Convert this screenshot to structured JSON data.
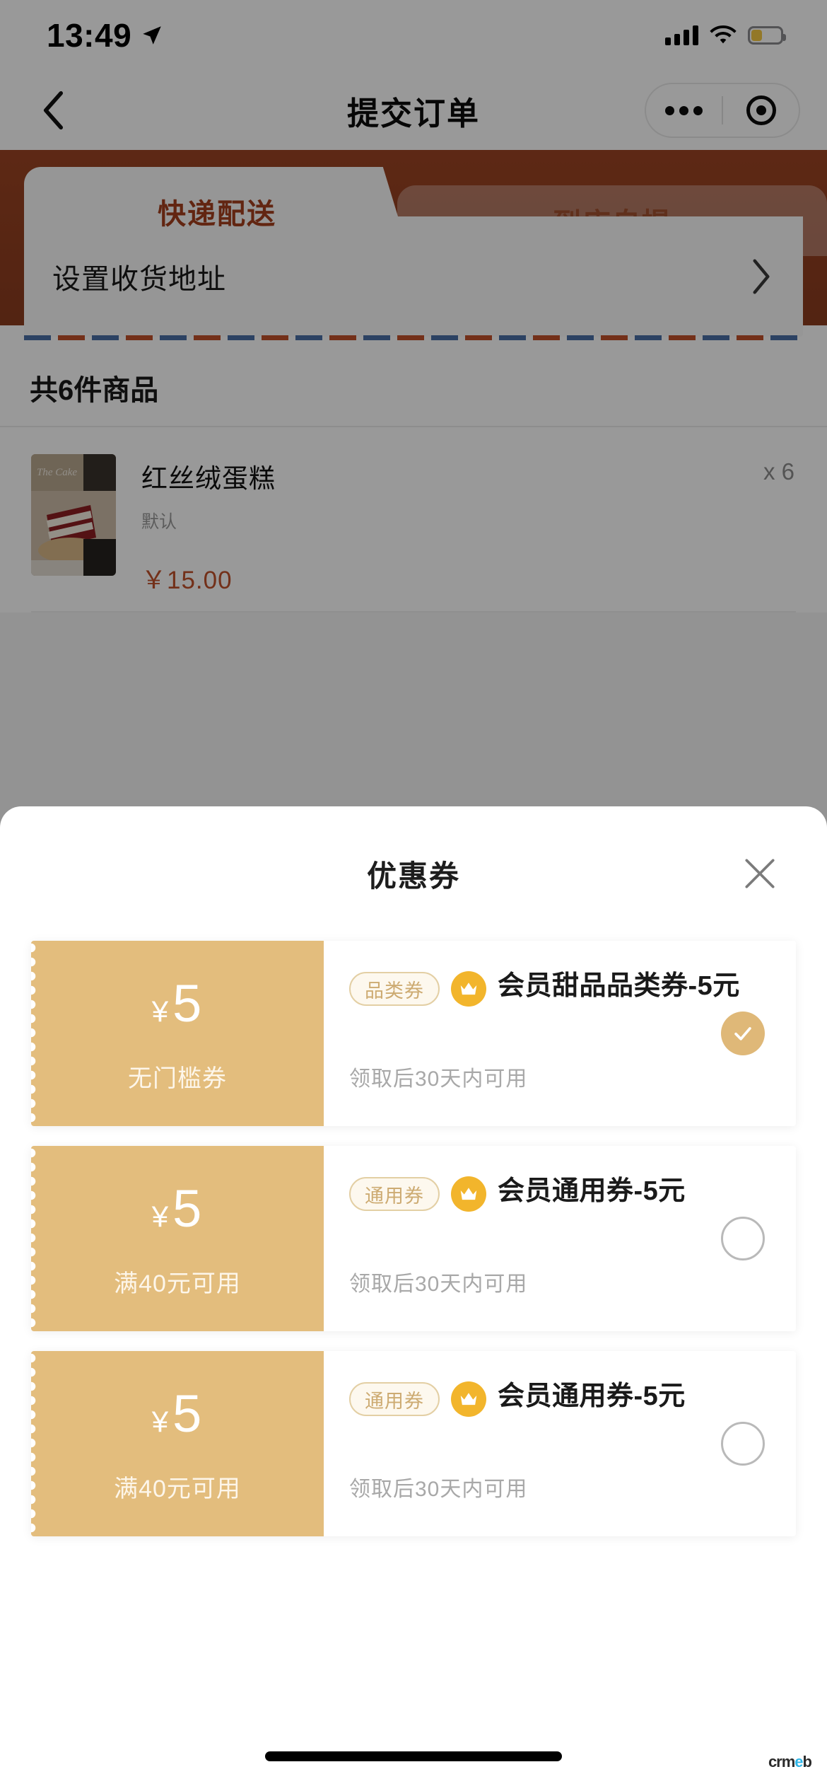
{
  "status_bar": {
    "time": "13:49",
    "location_icon": "location-arrow-icon",
    "signal_icon": "cellular-signal-icon",
    "wifi_icon": "wifi-icon",
    "battery_icon": "battery-icon"
  },
  "nav": {
    "back_icon": "chevron-left-icon",
    "title": "提交订单",
    "more_icon": "more-dots-icon",
    "target_icon": "target-circle-icon"
  },
  "order": {
    "tabs": [
      {
        "label": "快递配送",
        "active": true
      },
      {
        "label": "到店自提",
        "active": false
      }
    ],
    "address": {
      "label": "设置收货地址",
      "chevron_icon": "chevron-right-icon"
    },
    "goods_summary": "共6件商品",
    "goods": [
      {
        "name": "红丝绒蛋糕",
        "spec": "默认",
        "price": "￥15.00",
        "qty": "x 6",
        "image_caption": "The Cake"
      }
    ]
  },
  "coupon_sheet": {
    "title": "优惠券",
    "close_icon": "close-x-icon",
    "coupons": [
      {
        "amount": "5",
        "currency": "¥",
        "condition": "无门槛券",
        "tag": "品类券",
        "crown_icon": "crown-icon",
        "title": "会员甜品品类券-5元",
        "subtitle": "领取后30天内可用",
        "selected": true
      },
      {
        "amount": "5",
        "currency": "¥",
        "condition": "满40元可用",
        "tag": "通用券",
        "crown_icon": "crown-icon",
        "title": "会员通用券-5元",
        "subtitle": "领取后30天内可用",
        "selected": false
      },
      {
        "amount": "5",
        "currency": "¥",
        "condition": "满40元可用",
        "tag": "通用券",
        "crown_icon": "crown-icon",
        "title": "会员通用券-5元",
        "subtitle": "领取后30天内可用",
        "selected": false
      }
    ]
  },
  "watermark": {
    "prefix": "crm",
    "accent": "e",
    "suffix": "b"
  },
  "colors": {
    "brand_brown": "#9c4423",
    "coupon_tan": "#e3bd7d",
    "crown_gold": "#f2b52c",
    "price_red": "#c0502a",
    "selected_check": "#dfb878"
  }
}
